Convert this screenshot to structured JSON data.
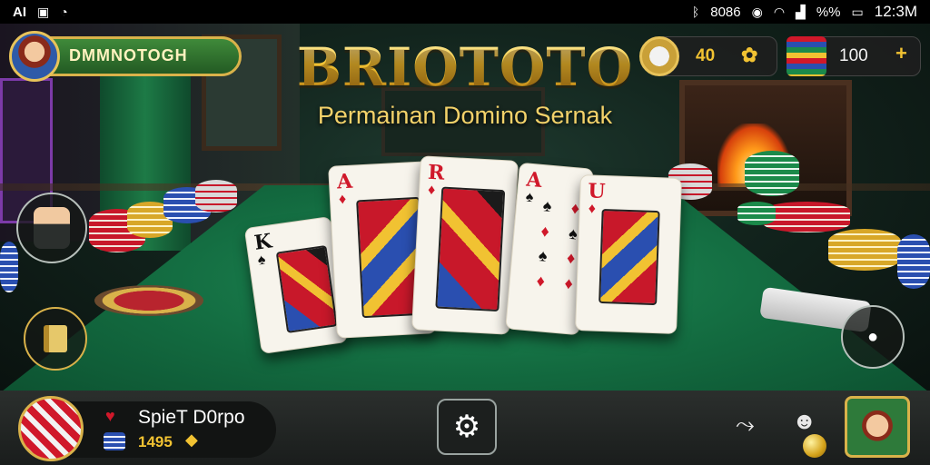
{
  "status_bar": {
    "left_text": "AI",
    "left_icons": [
      "image-icon",
      "timer-icon"
    ],
    "bluetooth": "ᛒ",
    "clock_text": "8086",
    "battery_percent_text": "%%",
    "time": "12:3M"
  },
  "title": "BRIOTOTO",
  "subtitle": "Permainan Domino Sernak",
  "player": {
    "name": "DMMNOTOGH"
  },
  "hud": {
    "coins": "40",
    "chips": "100",
    "add_glyph": "+"
  },
  "cards": [
    {
      "rank": "K",
      "suit": "♠",
      "suit_color": "blk"
    },
    {
      "rank": "A",
      "suit": "♦",
      "suit_color": "red"
    },
    {
      "rank": "R",
      "suit": "♦",
      "suit_color": "red"
    },
    {
      "rank": "A",
      "suit": "♠",
      "suit_color": "blk"
    },
    {
      "rank": "U",
      "suit": "♦",
      "suit_color": "red"
    }
  ],
  "bottom": {
    "name": "SpieT D0rpo",
    "coins": "1495",
    "settings_glyph": "⚙"
  },
  "colors": {
    "gold": "#f1c232",
    "felt": "#136b40",
    "red": "#d0182a"
  }
}
